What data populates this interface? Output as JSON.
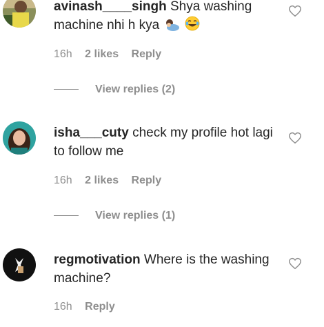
{
  "comments": [
    {
      "username": "avinash____singh",
      "text": "Shya washing machine nhi h kya",
      "emojis": [
        "person-bowing-emoji",
        "tears-of-joy-emoji"
      ],
      "time": "16h",
      "likes": "2 likes",
      "reply": "Reply",
      "view_replies": "View replies (2)"
    },
    {
      "username": "isha___cuty",
      "text": "check my profile hot lagi to follow me",
      "time": "16h",
      "likes": "2 likes",
      "reply": "Reply",
      "view_replies": "View replies (1)"
    },
    {
      "username": "regmotivation",
      "text": "Where is the washing machine?",
      "time": "16h",
      "reply": "Reply"
    }
  ],
  "colors": {
    "text": "#262626",
    "muted": "#8e8e8e",
    "heart_stroke": "#8e8e8e"
  }
}
